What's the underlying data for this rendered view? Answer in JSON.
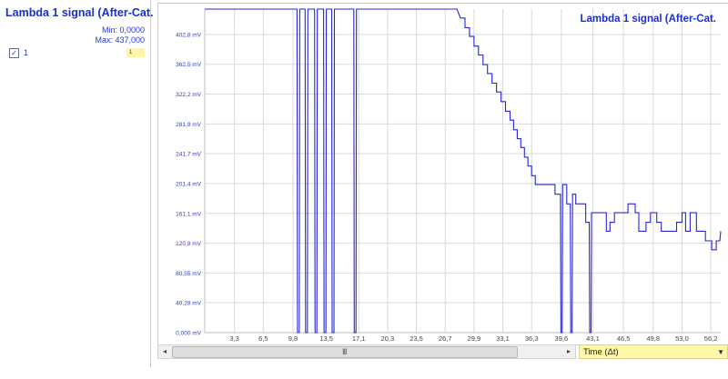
{
  "panel": {
    "title": "Lambda 1 signal (After-Cat.",
    "min_label": "Min: 0,0000",
    "max_label": "Max: 437,000",
    "channel": {
      "checked": true,
      "check_glyph": "✓",
      "label": "1",
      "swatch_label": "1",
      "swatch_color": "#fff7a8"
    }
  },
  "scrollbar": {
    "left_glyph": "◂",
    "right_glyph": "▸",
    "grip_glyph": "III"
  },
  "x_axis_selector": {
    "value": "Time (Δt)",
    "arrow_glyph": "▼"
  },
  "colors": {
    "trace": "#2626d6",
    "grid": "#d9d9d9",
    "accent": "#1a2fd0"
  },
  "chart_data": {
    "type": "line",
    "title": "Lambda 1 signal (After-Cat.",
    "xlabel": "Time (Δt)",
    "ylabel": "",
    "xlim": [
      0,
      57.3
    ],
    "ylim": [
      0,
      437
    ],
    "grid": true,
    "y_ticks": [
      0,
      40.28,
      80.55,
      120.8,
      161.1,
      201.4,
      241.7,
      281.9,
      322.2,
      362.5,
      402.8
    ],
    "y_tick_labels": [
      "0,000 mV",
      "40,28 mV",
      "80,55 mV",
      "120,8 mV",
      "161,1 mV",
      "201,4 mV",
      "241,7 mV",
      "281,9 mV",
      "322,2 mV",
      "362,5 mV",
      "402,8 mV"
    ],
    "x_ticks": [
      3.3,
      6.5,
      9.8,
      13.5,
      17.1,
      20.3,
      23.5,
      26.7,
      29.9,
      33.1,
      36.3,
      39.6,
      43.1,
      46.5,
      49.8,
      53.0,
      56.2
    ],
    "x_tick_labels": [
      "3,3",
      "6,5",
      "9,8",
      "13,5",
      "17,1",
      "20,3",
      "23,5",
      "26,7",
      "29,9",
      "33,1",
      "36,3",
      "39,6",
      "43,1",
      "46,5",
      "49,8",
      "53,0",
      "56,2"
    ],
    "series": [
      {
        "points": [
          [
            0,
            437
          ],
          [
            10.25,
            437
          ],
          [
            10.3,
            0
          ],
          [
            10.5,
            0
          ],
          [
            10.55,
            437
          ],
          [
            11.15,
            437
          ],
          [
            11.2,
            0
          ],
          [
            11.4,
            0
          ],
          [
            11.45,
            437
          ],
          [
            12.2,
            437
          ],
          [
            12.25,
            0
          ],
          [
            12.45,
            0
          ],
          [
            12.5,
            437
          ],
          [
            13.2,
            437
          ],
          [
            13.25,
            0
          ],
          [
            13.45,
            0
          ],
          [
            13.5,
            437
          ],
          [
            14.1,
            437
          ],
          [
            14.15,
            0
          ],
          [
            14.35,
            0
          ],
          [
            14.4,
            437
          ],
          [
            16.55,
            437
          ],
          [
            16.6,
            0
          ],
          [
            16.8,
            0
          ],
          [
            16.85,
            437
          ],
          [
            28.0,
            437
          ],
          [
            28.4,
            425
          ],
          [
            28.9,
            425
          ],
          [
            28.9,
            412
          ],
          [
            29.4,
            412
          ],
          [
            29.4,
            400
          ],
          [
            29.9,
            400
          ],
          [
            29.9,
            387
          ],
          [
            30.4,
            387
          ],
          [
            30.4,
            375
          ],
          [
            30.9,
            375
          ],
          [
            30.9,
            362
          ],
          [
            31.4,
            362
          ],
          [
            31.4,
            350
          ],
          [
            31.9,
            350
          ],
          [
            31.9,
            337
          ],
          [
            32.4,
            337
          ],
          [
            32.4,
            325
          ],
          [
            32.9,
            325
          ],
          [
            32.9,
            312
          ],
          [
            33.4,
            312
          ],
          [
            33.4,
            299
          ],
          [
            33.9,
            299
          ],
          [
            33.9,
            287
          ],
          [
            34.3,
            287
          ],
          [
            34.3,
            274
          ],
          [
            34.7,
            274
          ],
          [
            34.7,
            262
          ],
          [
            35.1,
            262
          ],
          [
            35.1,
            250
          ],
          [
            35.5,
            250
          ],
          [
            35.5,
            237
          ],
          [
            35.9,
            237
          ],
          [
            35.9,
            225
          ],
          [
            36.3,
            225
          ],
          [
            36.3,
            212
          ],
          [
            36.7,
            212
          ],
          [
            36.7,
            200
          ],
          [
            38.9,
            200
          ],
          [
            38.9,
            187
          ],
          [
            39.5,
            187
          ],
          [
            39.55,
            0
          ],
          [
            39.7,
            0
          ],
          [
            39.75,
            200
          ],
          [
            40.2,
            200
          ],
          [
            40.2,
            174
          ],
          [
            40.6,
            174
          ],
          [
            40.65,
            0
          ],
          [
            40.8,
            0
          ],
          [
            40.85,
            187
          ],
          [
            41.2,
            187
          ],
          [
            41.2,
            174
          ],
          [
            42.3,
            174
          ],
          [
            42.3,
            149
          ],
          [
            42.7,
            149
          ],
          [
            42.75,
            0
          ],
          [
            42.9,
            0
          ],
          [
            42.95,
            162
          ],
          [
            44.6,
            162
          ],
          [
            44.6,
            137
          ],
          [
            45.0,
            137
          ],
          [
            45.0,
            149
          ],
          [
            45.5,
            149
          ],
          [
            45.5,
            162
          ],
          [
            47.0,
            162
          ],
          [
            47.0,
            174
          ],
          [
            47.8,
            174
          ],
          [
            47.8,
            162
          ],
          [
            48.2,
            162
          ],
          [
            48.2,
            137
          ],
          [
            49.0,
            137
          ],
          [
            49.0,
            149
          ],
          [
            49.5,
            149
          ],
          [
            49.5,
            162
          ],
          [
            50.2,
            162
          ],
          [
            50.2,
            149
          ],
          [
            50.7,
            149
          ],
          [
            50.7,
            137
          ],
          [
            52.4,
            137
          ],
          [
            52.4,
            149
          ],
          [
            53.0,
            149
          ],
          [
            53.0,
            162
          ],
          [
            53.4,
            162
          ],
          [
            53.4,
            137
          ],
          [
            53.9,
            137
          ],
          [
            53.9,
            162
          ],
          [
            54.6,
            162
          ],
          [
            54.6,
            137
          ],
          [
            55.6,
            137
          ],
          [
            55.6,
            124
          ],
          [
            56.3,
            124
          ],
          [
            56.3,
            112
          ],
          [
            56.8,
            112
          ],
          [
            56.8,
            124
          ],
          [
            57.2,
            124
          ],
          [
            57.3,
            137
          ]
        ]
      }
    ]
  }
}
